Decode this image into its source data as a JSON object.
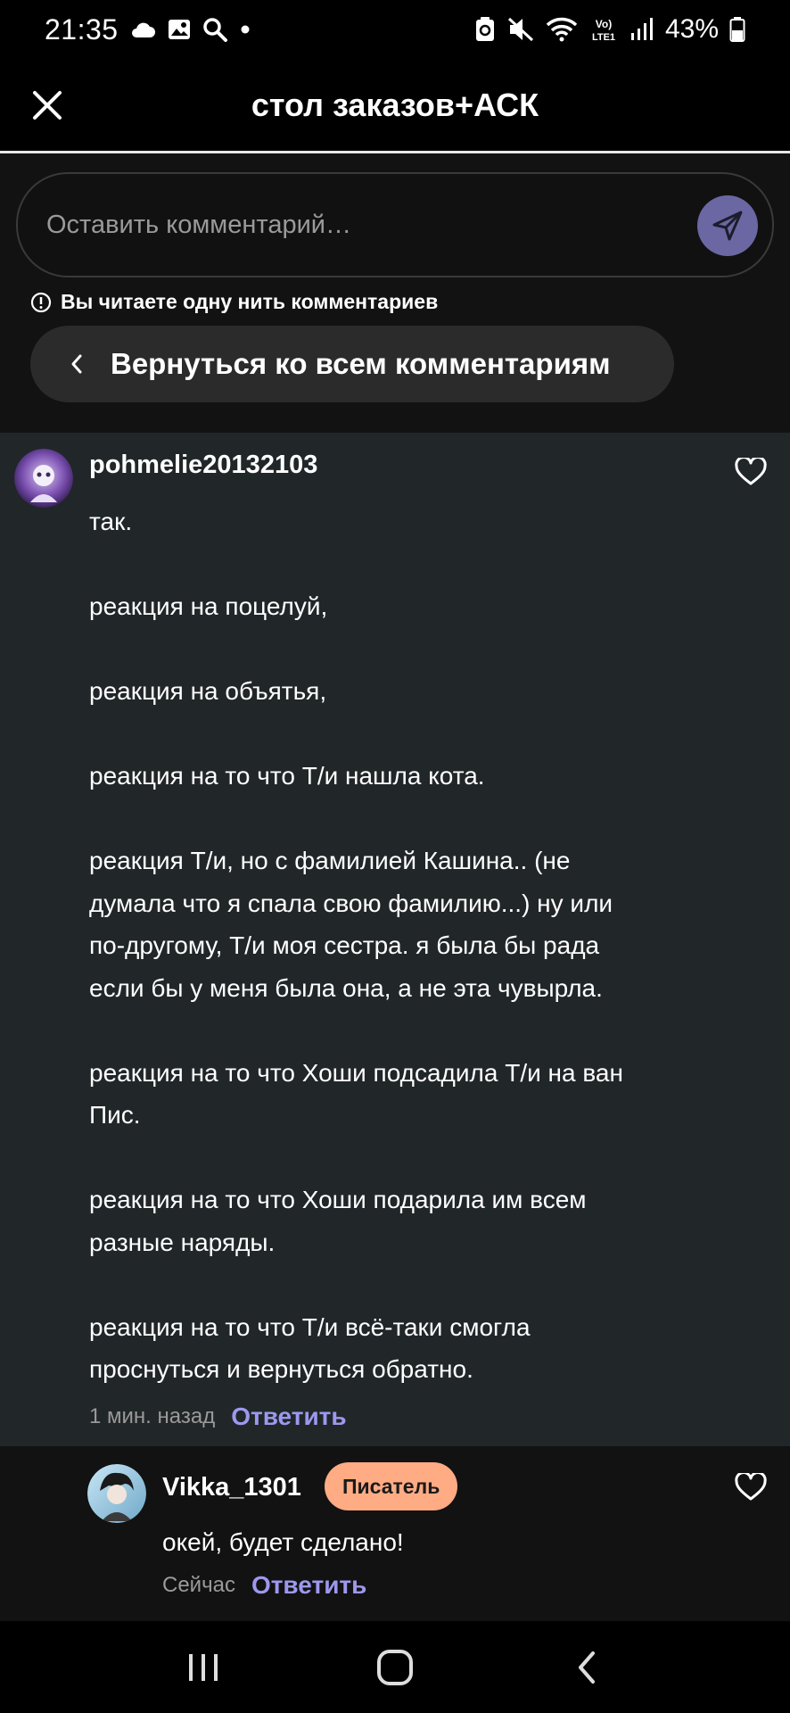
{
  "status_bar": {
    "time": "21:35",
    "battery": "43%",
    "left_icons": [
      "cloud-icon",
      "gallery-icon",
      "search-icon",
      "dot-icon"
    ],
    "right_icons": [
      "recycle-icon",
      "mute-icon",
      "wifi-icon",
      "volte-icon",
      "signal-icon",
      "battery-icon"
    ],
    "volte_label": "Vo) LTE1"
  },
  "header": {
    "title": "стол заказов+АСК"
  },
  "compose": {
    "placeholder": "Оставить комментарий…",
    "thread_notice": "Вы читаете одну нить комментариев",
    "back_all_label": "Вернуться ко всем комментариям"
  },
  "main_comment": {
    "username": "pohmelie20132103",
    "lines": [
      "так.",
      "",
      "реакция на поцелуй,",
      "",
      "реакция на объятья,",
      "",
      "реакция на то что Т/и нашла кота.",
      "",
      "реакция Т/и, но с фамилией Кашина.. (не",
      "думала что я спала свою фамилию...) ну или",
      "по-другому, Т/и моя сестра. я была бы рада",
      "если бы у меня была она, а не эта чувырла.",
      "",
      "реакция на то что Хоши подсадила Т/и на ван",
      "Пис.",
      "",
      "реакция на то что Хоши подарила им всем",
      "разные наряды.",
      "",
      "реакция на то что Т/и всё-таки смогла",
      "проснуться и вернуться обратно."
    ],
    "time": "1 мин. назад",
    "reply_label": "Ответить"
  },
  "reply_comment": {
    "username": "Vikka_1301",
    "badge": "Писатель",
    "text": "окей, будет сделано!",
    "time": "Сейчас",
    "reply_label": "Ответить"
  },
  "colors": {
    "accent": "#9d98ee",
    "send_button": "#6b67a3",
    "badge": "#ffab84",
    "comment_bg": "#212629"
  }
}
